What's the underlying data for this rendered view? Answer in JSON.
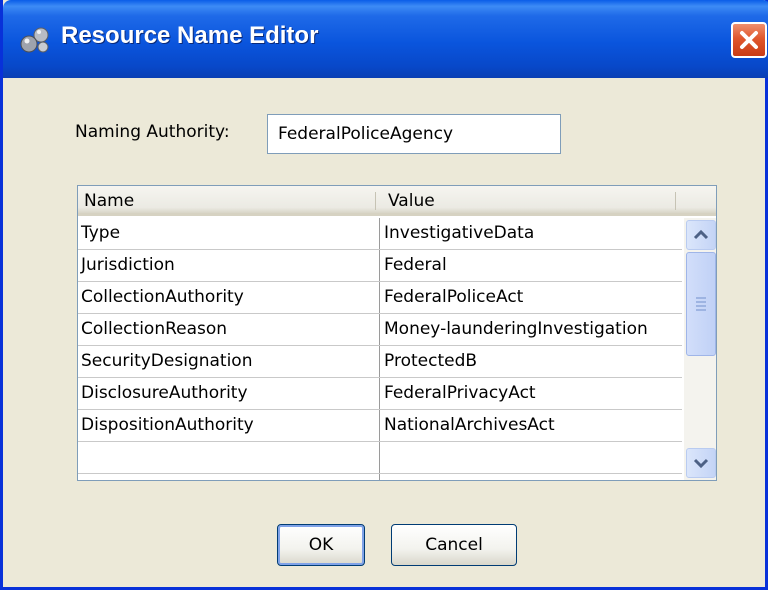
{
  "window": {
    "title": "Resource Name Editor"
  },
  "form": {
    "naming_authority_label": "Naming Authority:",
    "naming_authority_value": "FederalPoliceAgency"
  },
  "table": {
    "columns": [
      "Name",
      "Value"
    ],
    "rows": [
      {
        "name": "Type",
        "value": "InvestigativeData"
      },
      {
        "name": "Jurisdiction",
        "value": "Federal"
      },
      {
        "name": "CollectionAuthority",
        "value": "FederalPoliceAct"
      },
      {
        "name": "CollectionReason",
        "value": "Money-launderingInvestigation"
      },
      {
        "name": "SecurityDesignation",
        "value": "ProtectedB"
      },
      {
        "name": "DisclosureAuthority",
        "value": "FederalPrivacyAct"
      },
      {
        "name": "DispositionAuthority",
        "value": "NationalArchivesAct"
      },
      {
        "name": "",
        "value": ""
      }
    ]
  },
  "buttons": {
    "ok": "OK",
    "cancel": "Cancel"
  },
  "icons": {
    "app": "app-spheres-icon",
    "close": "close-icon",
    "scroll_up": "chevron-up-icon",
    "scroll_down": "chevron-down-icon",
    "scroll_grip": "grip-icon"
  },
  "colors": {
    "titlebar": "#0a55dd",
    "window_bg": "#ece9d8",
    "close": "#e0572d"
  }
}
